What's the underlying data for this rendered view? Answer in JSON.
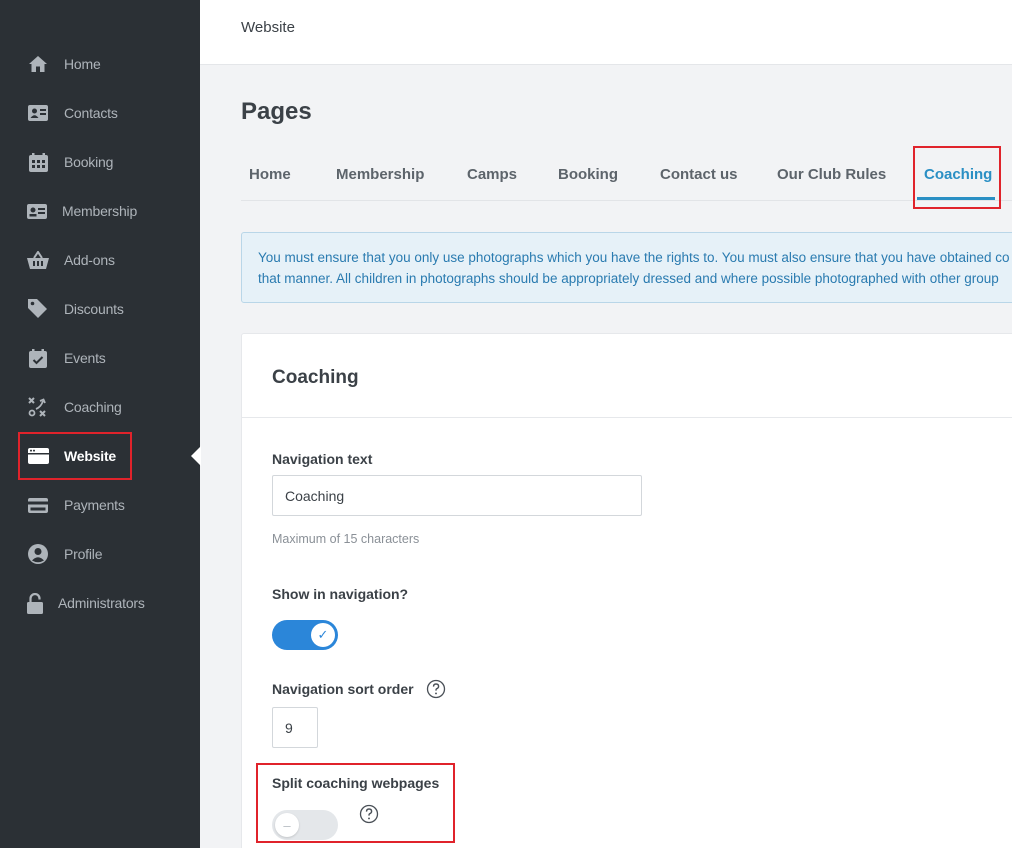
{
  "sidebar": {
    "items": [
      {
        "label": "Home",
        "icon": "home-icon"
      },
      {
        "label": "Contacts",
        "icon": "contact-card-icon"
      },
      {
        "label": "Booking",
        "icon": "calendar-icon"
      },
      {
        "label": "Membership",
        "icon": "id-card-icon"
      },
      {
        "label": "Add-ons",
        "icon": "basket-icon"
      },
      {
        "label": "Discounts",
        "icon": "tag-icon"
      },
      {
        "label": "Events",
        "icon": "calendar-check-icon"
      },
      {
        "label": "Coaching",
        "icon": "tactics-icon"
      },
      {
        "label": "Website",
        "icon": "browser-icon",
        "active": true
      },
      {
        "label": "Payments",
        "icon": "credit-card-icon"
      },
      {
        "label": "Profile",
        "icon": "user-circle-icon"
      },
      {
        "label": "Administrators",
        "icon": "lock-icon"
      }
    ]
  },
  "topbar": {
    "title": "Website"
  },
  "page": {
    "title": "Pages"
  },
  "tabs": [
    {
      "label": "Home"
    },
    {
      "label": "Membership"
    },
    {
      "label": "Camps"
    },
    {
      "label": "Booking"
    },
    {
      "label": "Contact us"
    },
    {
      "label": "Our Club Rules"
    },
    {
      "label": "Coaching",
      "active": true
    }
  ],
  "alert": {
    "line1": "You must ensure that you only use photographs which you have the rights to. You must also ensure that you have obtained co",
    "line2": "that manner. All children in photographs should be appropriately dressed and where possible photographed with other group"
  },
  "card": {
    "title": "Coaching",
    "navigation_text": {
      "label": "Navigation text",
      "value": "Coaching",
      "hint": "Maximum of 15 characters"
    },
    "show_in_navigation": {
      "label": "Show in navigation?",
      "checked": true,
      "knob_glyph": "✓"
    },
    "sort_order": {
      "label": "Navigation sort order",
      "value": "9"
    },
    "split_pages": {
      "label": "Split coaching webpages",
      "checked": false,
      "knob_glyph": "–"
    }
  },
  "colors": {
    "accent": "#2a8fc4",
    "toggle_on": "#2b86d9",
    "highlight": "#e0232b",
    "sidebar": "#2b3035"
  }
}
